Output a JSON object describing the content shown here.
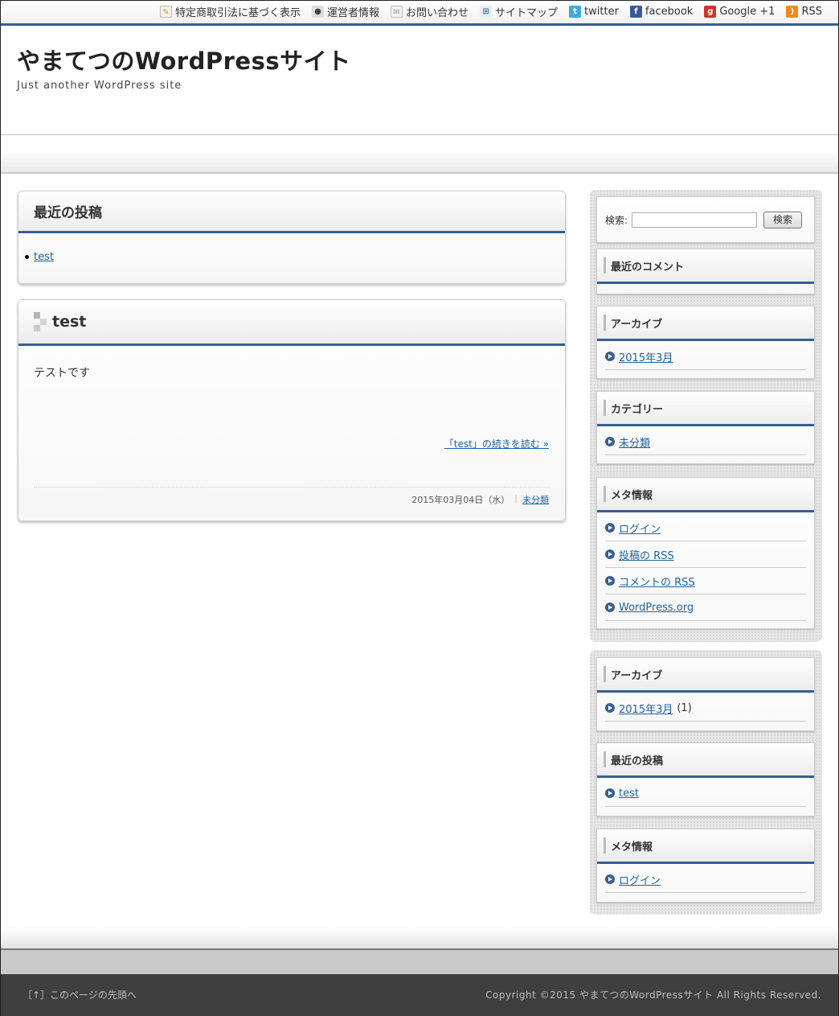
{
  "topnav": [
    {
      "label": "特定商取引法に基づく表示",
      "icon": "memo-icon"
    },
    {
      "label": "運営者情報",
      "icon": "person-icon"
    },
    {
      "label": "お問い合わせ",
      "icon": "mail-icon"
    },
    {
      "label": "サイトマップ",
      "icon": "sitemap-icon"
    },
    {
      "label": "twitter",
      "icon": "twitter-icon"
    },
    {
      "label": "facebook",
      "icon": "facebook-icon"
    },
    {
      "label": "Google +1",
      "icon": "google-plus-icon"
    },
    {
      "label": "RSS",
      "icon": "rss-icon"
    }
  ],
  "site": {
    "title": "やまてつのWordPressサイト",
    "description": "Just another WordPress site"
  },
  "main": {
    "recent": {
      "title": "最近の投稿",
      "items": [
        "test"
      ]
    },
    "post": {
      "title": "test",
      "body": "テストです",
      "readmore": "「test」の続きを読む »",
      "date": "2015年03月04日（水）",
      "category": "未分類"
    }
  },
  "sidebar1": {
    "search_label": "検索:",
    "search_button": "検索",
    "recent_comments": {
      "title": "最近のコメント"
    },
    "archive": {
      "title": "アーカイブ",
      "items": [
        "2015年3月"
      ]
    },
    "categories": {
      "title": "カテゴリー",
      "items": [
        "未分類"
      ]
    },
    "meta": {
      "title": "メタ情報",
      "items": [
        "ログイン",
        "投稿の RSS",
        "コメントの RSS",
        "WordPress.org"
      ]
    }
  },
  "sidebar2": {
    "archive": {
      "title": "アーカイブ",
      "items": [
        "2015年3月"
      ],
      "count": "(1)"
    },
    "recent": {
      "title": "最近の投稿",
      "items": [
        "test"
      ]
    },
    "meta": {
      "title": "メタ情報",
      "items": [
        "ログイン"
      ]
    }
  },
  "footer": {
    "to_top": "［↑］このページの先頭へ",
    "copyright": "Copyright ©2015 やまてつのWordPressサイト All Rights Reserved."
  },
  "colors": {
    "accent": "#375f91",
    "link": "#1e63a3",
    "footer_bg": "#3f3f3f"
  }
}
